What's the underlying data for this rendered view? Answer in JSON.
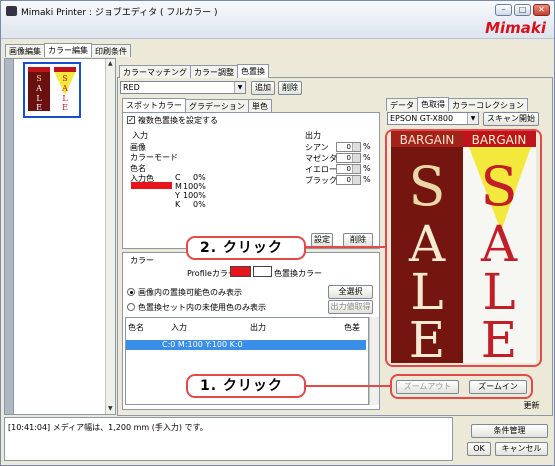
{
  "window": {
    "title": "Mimaki Printer : ジョブエディタ ( フルカラー )",
    "brand": "Mimaki",
    "min": "–",
    "max": "□",
    "close": "✕"
  },
  "main_tabs": [
    "画像編集",
    "カラー編集",
    "印刷条件"
  ],
  "thumb": {
    "sale": [
      "SALE",
      "SALE"
    ]
  },
  "color_tabs": [
    "カラーマッチング",
    "カラー調整",
    "色置換"
  ],
  "replace_select": "RED",
  "buttons": {
    "add": "追加",
    "delete": "削除"
  },
  "spot_tabs": [
    "スポットカラー",
    "グラデーション",
    "単色"
  ],
  "checkbox_label": "複数色置換を設定する",
  "input": {
    "header": "入力",
    "rows": [
      "画像",
      "カラーモード",
      "色名",
      "入力色"
    ],
    "cmyk": [
      [
        "C",
        "0%"
      ],
      [
        "M",
        "100%"
      ],
      [
        "Y",
        "100%"
      ],
      [
        "K",
        "0%"
      ]
    ],
    "swatch_color": "#e8141b"
  },
  "output": {
    "header": "出力",
    "rows": [
      [
        "シアン",
        "0"
      ],
      [
        "マゼンタ",
        "0"
      ],
      [
        "イエロー",
        "0"
      ],
      [
        "ブラック",
        "0"
      ]
    ],
    "unit": "%"
  },
  "settings_btn": "設定",
  "delete2": "削除",
  "color_section": {
    "header": "カラー",
    "profile_label": "Profileカラー",
    "replace_label": "色置換カラー",
    "swatch_color": "#e8141b"
  },
  "radios": [
    "画像内の置換可能色のみ表示",
    "色置換セット内の未使用色のみ表示"
  ],
  "select_all": "全選択",
  "get_output": "出力値取得",
  "table": {
    "columns": [
      "色名",
      "入力",
      "出力",
      "色差"
    ],
    "row": "C:0 M:100 Y:100 K:0"
  },
  "right_tabs": [
    "データ",
    "色取得",
    "カラーコレクション"
  ],
  "printer_select": "EPSON GT-X800",
  "scan_start": "スキャン開始",
  "preview": {
    "banner": [
      "BARGAIN",
      "BARGAIN"
    ],
    "letters": [
      "S",
      "A",
      "L",
      "E"
    ]
  },
  "zoom_out": "ズームアウト",
  "zoom_in": "ズームイン",
  "update": "更新",
  "callouts": {
    "c2": "2. クリック",
    "c1": "1. クリック"
  },
  "status": "[10:41:04] メディア幅は、1,200 mm (手入力) です。",
  "footer": {
    "cond": "条件管理",
    "ok": "OK",
    "cancel": "キャンセル"
  }
}
